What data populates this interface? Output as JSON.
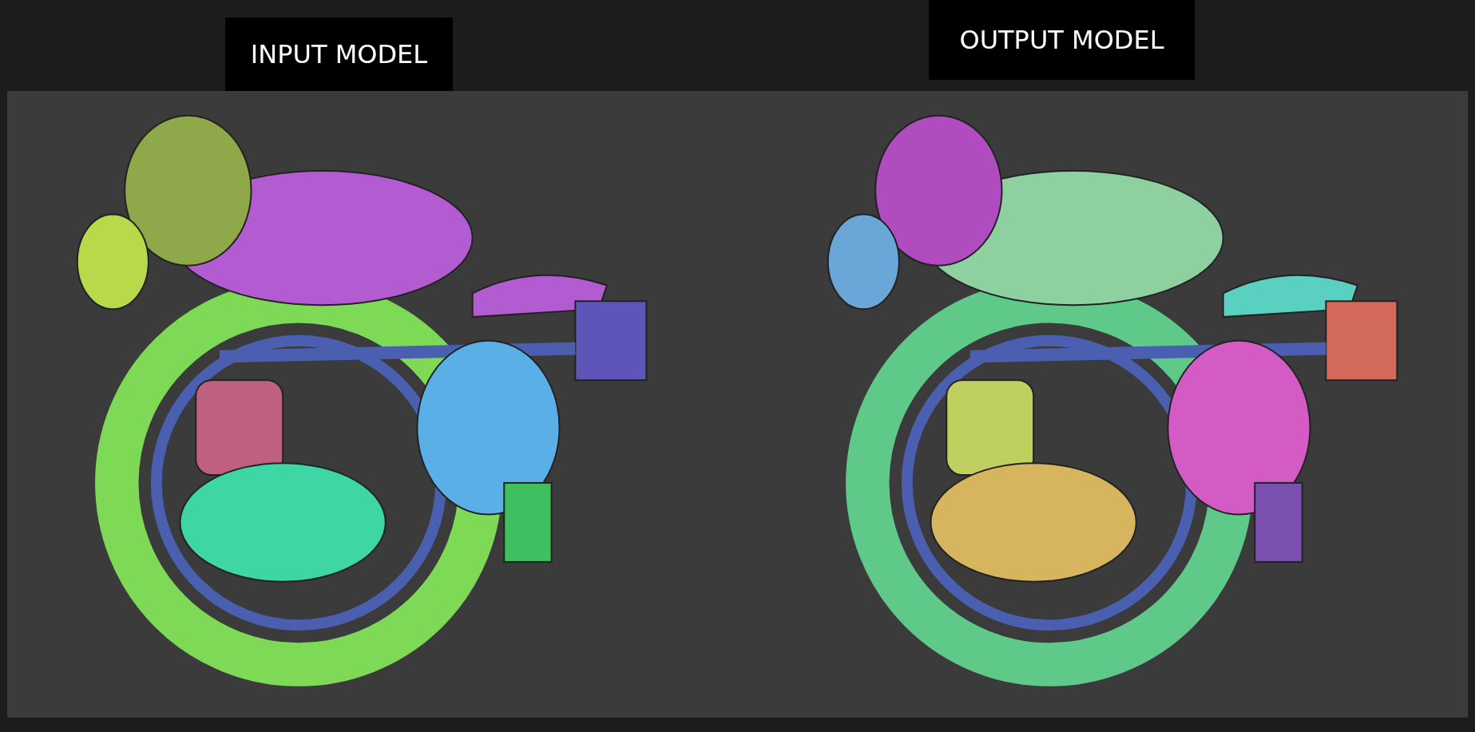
{
  "labels": [
    {
      "text": "INPUT MODEL"
    },
    {
      "text": "OUTPUT MODEL"
    }
  ]
}
